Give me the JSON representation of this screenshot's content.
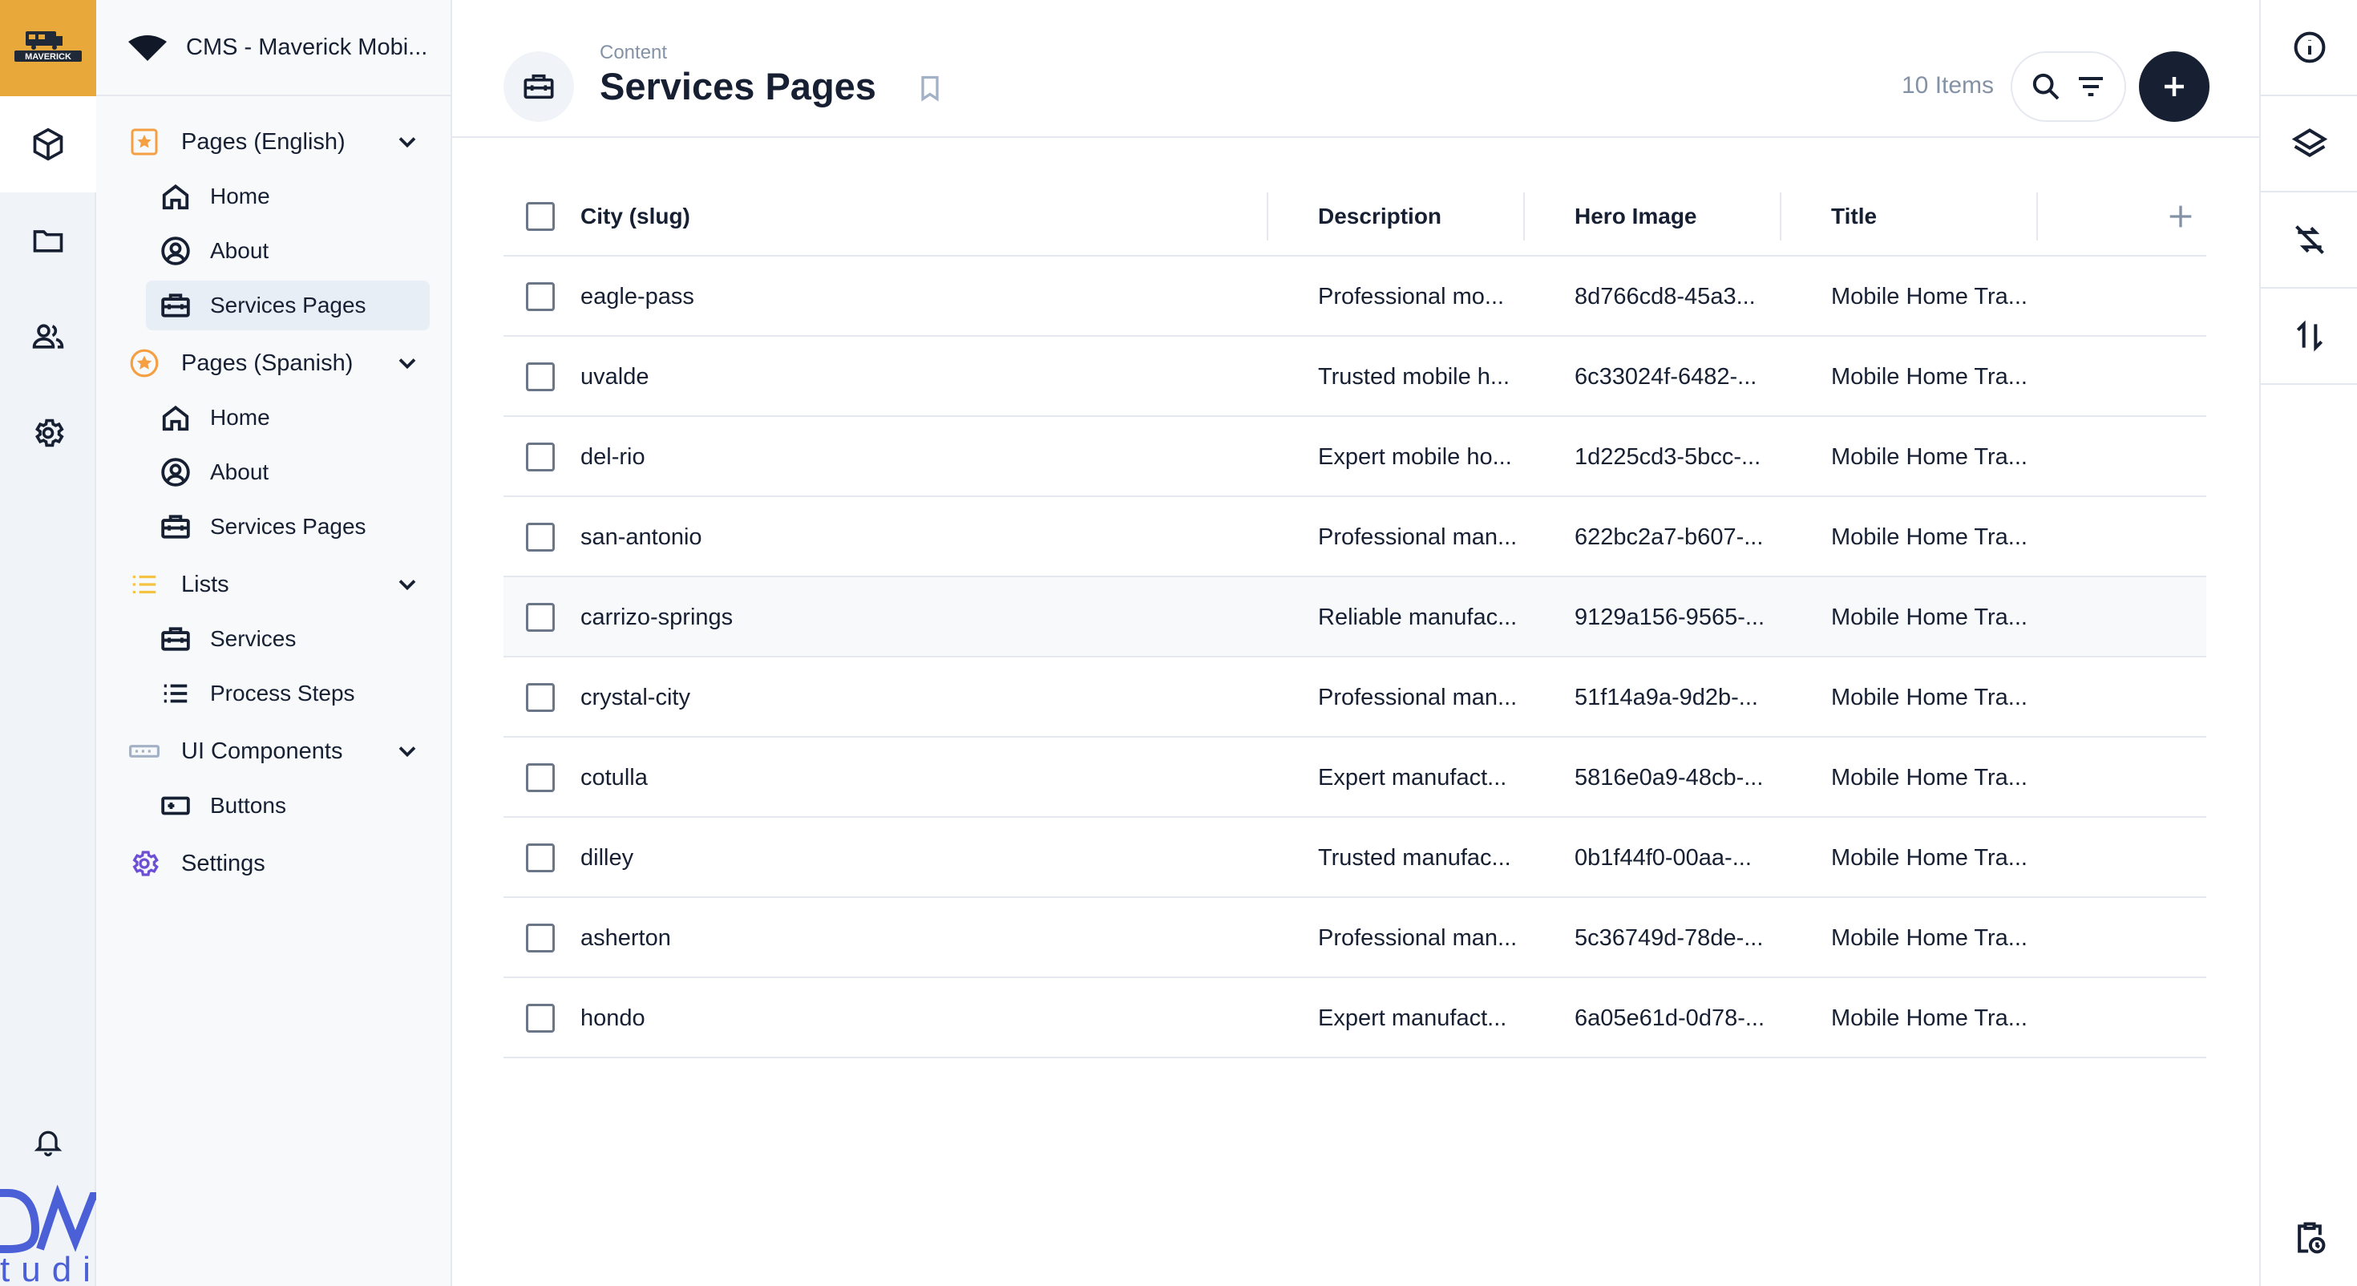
{
  "brand": {
    "logo_text": "MAVERICK",
    "studio_mark": "DM studio"
  },
  "module_bar": {
    "items": [
      {
        "icon": "cube-icon",
        "active": true
      },
      {
        "icon": "folder-icon",
        "active": false
      },
      {
        "icon": "users-icon",
        "active": false
      },
      {
        "icon": "gear-icon",
        "active": false
      }
    ],
    "bottom_icon": "bell-icon"
  },
  "navigation": {
    "project_name": "CMS - Maverick Mobi...",
    "groups": [
      {
        "label": "Pages (English)",
        "icon": "star-square-icon",
        "color": "#f59e42",
        "items": [
          {
            "label": "Home",
            "icon": "home-icon"
          },
          {
            "label": "About",
            "icon": "user-circle-icon"
          },
          {
            "label": "Services Pages",
            "icon": "toolbox-icon",
            "active": true
          }
        ]
      },
      {
        "label": "Pages (Spanish)",
        "icon": "star-circle-icon",
        "color": "#f59e42",
        "items": [
          {
            "label": "Home",
            "icon": "home-icon"
          },
          {
            "label": "About",
            "icon": "user-circle-icon"
          },
          {
            "label": "Services Pages",
            "icon": "toolbox-icon"
          }
        ]
      },
      {
        "label": "Lists",
        "icon": "list-icon",
        "color": "#f5c342",
        "items": [
          {
            "label": "Services",
            "icon": "toolbox-icon"
          },
          {
            "label": "Process Steps",
            "icon": "list-icon"
          }
        ]
      },
      {
        "label": "UI Components",
        "icon": "component-icon",
        "color": "#a3b1c6",
        "items": [
          {
            "label": "Buttons",
            "icon": "button-icon"
          }
        ]
      }
    ],
    "settings_label": "Settings",
    "settings_color": "#6d4fd6"
  },
  "header": {
    "breadcrumb": "Content",
    "title": "Services Pages",
    "item_count": "10 Items"
  },
  "table": {
    "columns": [
      "City (slug)",
      "Description",
      "Hero Image",
      "Title"
    ],
    "rows": [
      [
        "eagle-pass",
        "Professional mo...",
        "8d766cd8-45a3...",
        "Mobile Home Tra..."
      ],
      [
        "uvalde",
        "Trusted mobile h...",
        "6c33024f-6482-...",
        "Mobile Home Tra..."
      ],
      [
        "del-rio",
        "Expert mobile ho...",
        "1d225cd3-5bcc-...",
        "Mobile Home Tra..."
      ],
      [
        "san-antonio",
        "Professional man...",
        "622bc2a7-b607-...",
        "Mobile Home Tra..."
      ],
      [
        "carrizo-springs",
        "Reliable manufac...",
        "9129a156-9565-...",
        "Mobile Home Tra..."
      ],
      [
        "crystal-city",
        "Professional man...",
        "51f14a9a-9d2b-...",
        "Mobile Home Tra..."
      ],
      [
        "cotulla",
        "Expert manufact...",
        "5816e0a9-48cb-...",
        "Mobile Home Tra..."
      ],
      [
        "dilley",
        "Trusted manufac...",
        "0b1f44f0-00aa-...",
        "Mobile Home Tra..."
      ],
      [
        "asherton",
        "Professional man...",
        "5c36749d-78de-...",
        "Mobile Home Tra..."
      ],
      [
        "hondo",
        "Expert manufact...",
        "6a05e61d-0d78-...",
        "Mobile Home Tra..."
      ]
    ],
    "hover_row": 4
  },
  "sidebar": {
    "items": [
      "info-icon",
      "layers-icon",
      "sync-off-icon",
      "sort-arrows-icon"
    ],
    "bottom_icon": "clipboard-clock-icon"
  },
  "colors": {
    "accent": "#e8a93a",
    "primary": "#172033",
    "muted": "#8492a6",
    "border": "#e5e9ef"
  }
}
